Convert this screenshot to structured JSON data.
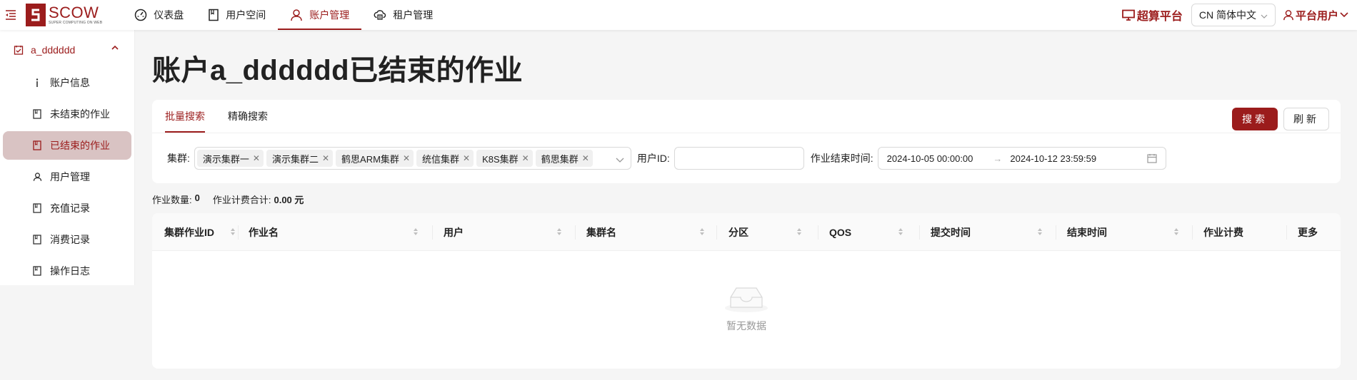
{
  "header": {
    "logo_name": "SCOW",
    "logo_sub": "SUPER COMPUTING ON WEB",
    "nav": [
      {
        "label": "仪表盘",
        "icon": "dashboard-icon"
      },
      {
        "label": "用户空间",
        "icon": "book-icon"
      },
      {
        "label": "账户管理",
        "icon": "user-icon"
      },
      {
        "label": "租户管理",
        "icon": "cloud-server-icon"
      }
    ],
    "platform_label": "超算平台",
    "language": "CN 简体中文",
    "user_label": "平台用户"
  },
  "sidebar": {
    "group_label": "a_dddddd",
    "items": [
      {
        "label": "账户信息",
        "icon": "info-icon"
      },
      {
        "label": "未结束的作业",
        "icon": "book-icon"
      },
      {
        "label": "已结束的作业",
        "icon": "book-icon"
      },
      {
        "label": "用户管理",
        "icon": "user-icon"
      },
      {
        "label": "充值记录",
        "icon": "book-icon"
      },
      {
        "label": "消费记录",
        "icon": "book-icon"
      },
      {
        "label": "操作日志",
        "icon": "book-icon"
      }
    ]
  },
  "page": {
    "title": "账户a_dddddd已结束的作业"
  },
  "search": {
    "tabs": [
      "批量搜索",
      "精确搜索"
    ],
    "search_button": "搜索",
    "refresh_button": "刷新",
    "cluster_label": "集群:",
    "clusters": [
      "演示集群一",
      "演示集群二",
      "鹤思ARM集群",
      "统信集群",
      "K8S集群",
      "鹤思集群"
    ],
    "user_id_label": "用户ID:",
    "user_id_value": "",
    "end_time_label": "作业结束时间:",
    "start_date": "2024-10-05 00:00:00",
    "end_date": "2024-10-12 23:59:59"
  },
  "summary": {
    "job_count_label": "作业数量:",
    "job_count": "0",
    "cost_label": "作业计费合计:",
    "cost_value": "0.00 元"
  },
  "table": {
    "columns": [
      "集群作业ID",
      "作业名",
      "用户",
      "集群名",
      "分区",
      "QOS",
      "提交时间",
      "结束时间",
      "作业计费",
      "更多"
    ],
    "empty_text": "暂无数据"
  },
  "colors": {
    "accent": "#9b1c1c",
    "active_bg": "#d9c3c3"
  }
}
